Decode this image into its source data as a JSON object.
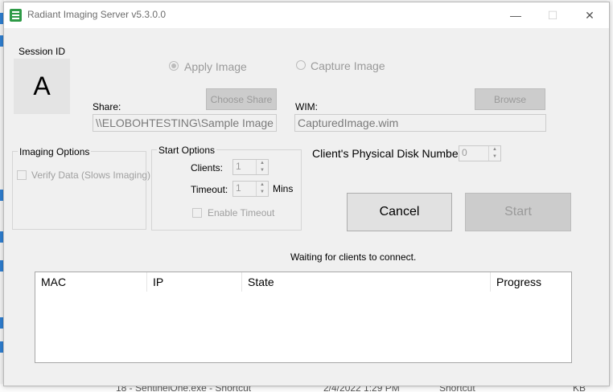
{
  "window": {
    "title": "Radiant Imaging Server v5.3.0.0"
  },
  "session": {
    "label": "Session ID",
    "value": "A"
  },
  "mode": {
    "apply_label": "Apply Image",
    "capture_label": "Capture Image",
    "selected": "apply"
  },
  "share": {
    "label": "Share:",
    "value": "\\\\ELOBOHTESTING\\Sample Image",
    "button": "Choose Share"
  },
  "wim": {
    "label": "WIM:",
    "value": "CapturedImage.wim",
    "button": "Browse"
  },
  "imaging_options": {
    "title": "Imaging Options",
    "verify_label": "Verify Data (Slows Imaging)",
    "verify_checked": false
  },
  "start_options": {
    "title": "Start Options",
    "clients_label": "Clients:",
    "clients_value": "1",
    "timeout_label": "Timeout:",
    "timeout_value": "1",
    "timeout_unit": "Mins",
    "enable_timeout_label": "Enable Timeout",
    "enable_timeout_checked": false
  },
  "disk": {
    "label": "Client's Physical Disk Number",
    "value": "0"
  },
  "actions": {
    "cancel": "Cancel",
    "start": "Start"
  },
  "status": "Waiting for clients to connect.",
  "clients_table": {
    "columns": [
      "MAC",
      "IP",
      "State",
      "Progress"
    ],
    "rows": []
  },
  "background": {
    "row_text": "18 - SentinelOne.exe - Shortcut",
    "row_date": "2/4/2022 1:29 PM",
    "row_type": "Shortcut",
    "row_size": "KB"
  },
  "icons": {
    "app": "app-icon",
    "minimize": "minimize-icon",
    "maximize": "maximize-icon",
    "close": "close-icon"
  }
}
